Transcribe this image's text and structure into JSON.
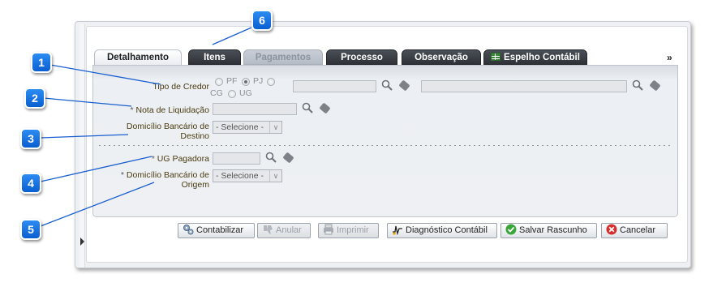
{
  "tabs": [
    {
      "label": "Detalhamento",
      "state": "active"
    },
    {
      "label": "Itens",
      "state": "normal"
    },
    {
      "label": "Pagamentos",
      "state": "disabled"
    },
    {
      "label": "Processo",
      "state": "normal"
    },
    {
      "label": "Observação",
      "state": "normal"
    },
    {
      "label": "Espelho Contábil",
      "state": "normal",
      "icon": "spreadsheet-icon"
    }
  ],
  "tab_more": "»",
  "form": {
    "tipo_credor_label": "Tipo de Credor",
    "tipo_credor_options": [
      "PF",
      "PJ",
      "CG",
      "UG"
    ],
    "tipo_credor_selected": "PJ",
    "required_mark": "*",
    "nota_liquidacao_label": "Nota de Liquidação",
    "domicilio_destino_label_1": "Domicílio Bancário de",
    "domicilio_destino_label_2": "Destino",
    "domicilio_destino_value": "- Selecione -",
    "ug_pagadora_label": "UG Pagadora",
    "domicilio_origem_label_1": "Domicílio Bancário de",
    "domicilio_origem_label_2": "Origem",
    "domicilio_origem_value": "- Selecione -"
  },
  "buttons": {
    "contabilizar": "Contabilizar",
    "anular": "Anular",
    "imprimir": "Imprimir",
    "diagnostico": "Diagnóstico Contábil",
    "salvar": "Salvar Rascunho",
    "cancelar": "Cancelar"
  },
  "callouts": [
    "1",
    "2",
    "3",
    "4",
    "5",
    "6"
  ],
  "colors": {
    "callout": "#1a73e8",
    "tab_dark": "#2e3237",
    "panel": "#eef0f3"
  }
}
